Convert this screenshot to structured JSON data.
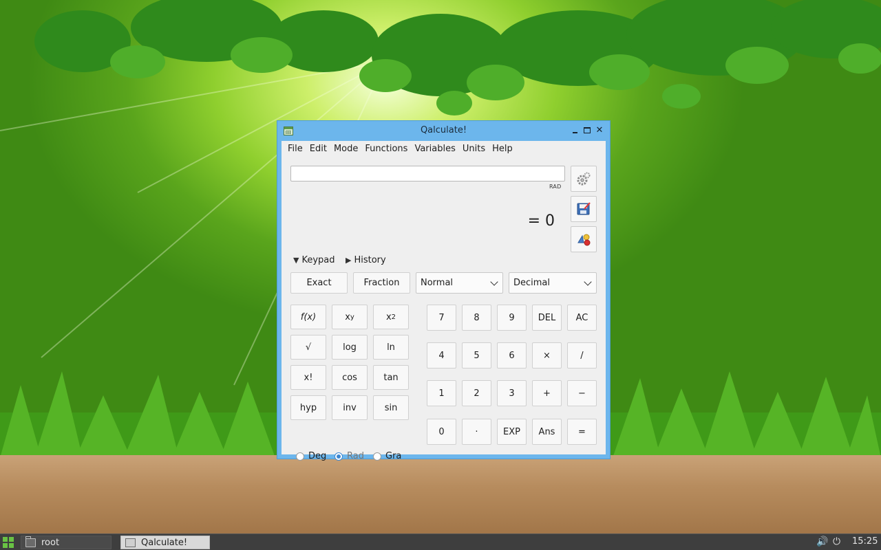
{
  "window": {
    "title": "Qalculate!",
    "minimize_glyph": "",
    "close_glyph": "✕"
  },
  "menu": {
    "items": [
      "File",
      "Edit",
      "Mode",
      "Functions",
      "Variables",
      "Units",
      "Help"
    ]
  },
  "expression": {
    "value": "",
    "angle_indicator": "RAD"
  },
  "result": {
    "text": "= 0"
  },
  "side_buttons": [
    "gear-icon",
    "save-icon",
    "convert-units-icon"
  ],
  "expanders": {
    "keypad": {
      "label": "Keypad",
      "expanded": true,
      "glyph": "▼"
    },
    "history": {
      "label": "History",
      "expanded": false,
      "glyph": "▶"
    }
  },
  "toolbar": {
    "exact": "Exact",
    "fraction": "Fraction",
    "mode_select": "Normal",
    "base_select": "Decimal"
  },
  "function_keys": {
    "fx": "f(x)",
    "xy_base": "x",
    "xy_exp": "y",
    "x2_base": "x",
    "x2_exp": "2",
    "sqrt": "√",
    "log": "log",
    "ln": "ln",
    "factorial": "x!",
    "cos": "cos",
    "tan": "tan",
    "hyp": "hyp",
    "inv": "inv",
    "sin": "sin"
  },
  "angle_units": {
    "deg": "Deg",
    "rad": "Rad",
    "gra": "Gra",
    "selected": "Rad"
  },
  "number_keys": {
    "row1": [
      "7",
      "8",
      "9",
      "DEL",
      "AC"
    ],
    "row2": [
      "4",
      "5",
      "6",
      "×",
      "/"
    ],
    "row3": [
      "1",
      "2",
      "3",
      "+",
      "−"
    ],
    "row4": [
      "0",
      "·",
      "EXP",
      "Ans",
      "="
    ]
  },
  "taskbar": {
    "tasks": [
      "root",
      "Qalculate!"
    ],
    "clock": "15:25",
    "volume_glyph": "🔊",
    "power_glyph": "⏻"
  },
  "colors": {
    "titlebar": "#6cb6ec",
    "radio_accent": "#3b86d1",
    "start_button": "#69c244"
  }
}
